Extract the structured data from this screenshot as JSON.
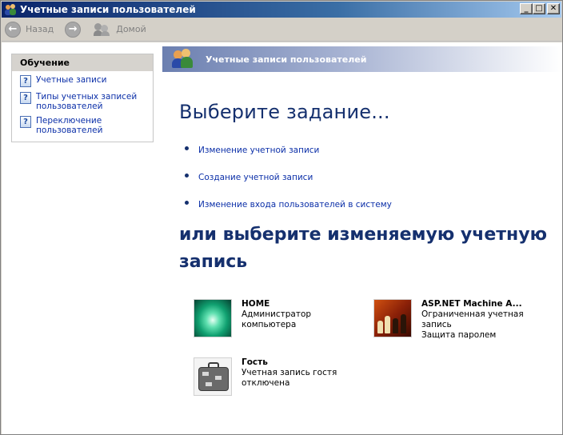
{
  "window": {
    "title": "Учетные записи пользователей",
    "buttons": {
      "minimize": "_",
      "maximize": "□",
      "close": "✕"
    }
  },
  "toolbar": {
    "back_label": "Назад",
    "forward_glyph": "→",
    "back_glyph": "←",
    "home_label": "Домой"
  },
  "sidebar": {
    "header": "Обучение",
    "items": [
      {
        "label": "Учетные записи",
        "icon": "help-icon"
      },
      {
        "label": "Типы учетных записей пользователей",
        "icon": "help-icon"
      },
      {
        "label": "Переключение пользователей",
        "icon": "help-icon"
      }
    ],
    "help_glyph": "?"
  },
  "banner": {
    "title": "Учетные записи пользователей"
  },
  "main": {
    "task_heading": "Выберите задание...",
    "tasks": [
      "Изменение учетной записи",
      "Создание учетной записи",
      "Изменение входа пользователей в систему"
    ],
    "account_heading": "или выберите изменяемую учетную запись",
    "accounts": [
      {
        "name": "HOME",
        "lines": [
          "Администратор",
          "компьютера"
        ],
        "picture": "water-drop"
      },
      {
        "name": "ASP.NET Machine A...",
        "lines": [
          "Ограниченная учетная",
          "запись",
          "Защита паролем"
        ],
        "picture": "chess"
      },
      {
        "name": "Гость",
        "lines": [
          "Учетная запись гостя",
          "отключена"
        ],
        "picture": "suitcase"
      }
    ]
  },
  "colors": {
    "heading": "#15306e",
    "link": "#0b2fa8",
    "titlebar_start": "#0a246a"
  }
}
